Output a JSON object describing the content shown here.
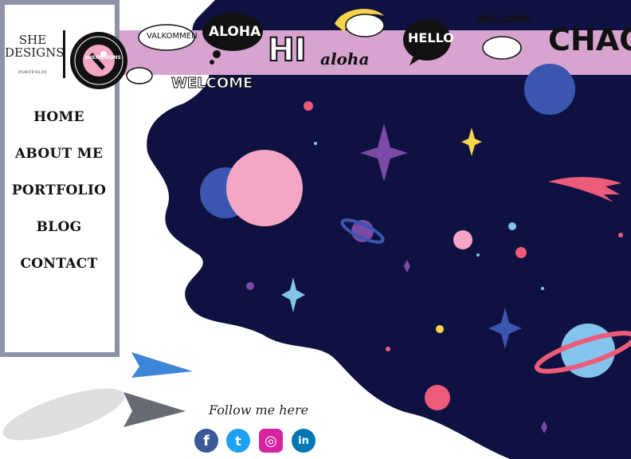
{
  "brand": {
    "line1": "SHE",
    "line2": "DESIGNS",
    "subtitle": "PORTFOLIO",
    "badge_text": "SHEIDESIGNS"
  },
  "nav": {
    "items": [
      {
        "label": "HOME"
      },
      {
        "label": "ABOUT ME"
      },
      {
        "label": "PORTFOLIO"
      },
      {
        "label": "BLOG"
      },
      {
        "label": "CONTACT"
      }
    ]
  },
  "greetings": {
    "valkommen": "VALKOMMEN",
    "aloha_bubble": "ALOHA",
    "hi": "HI",
    "aloha_script": "aloha",
    "hello": "HELLO",
    "welcome_small": "WELCOME",
    "welcome_large": "WELCOME",
    "chao": "CHAO"
  },
  "footer": {
    "follow_text": "Follow me here",
    "social": [
      {
        "name": "facebook",
        "glyph": "f",
        "color": "#3b5998"
      },
      {
        "name": "twitter",
        "glyph": "t",
        "color": "#1da1f2"
      },
      {
        "name": "instagram",
        "glyph": "◎",
        "color": "#d6249f"
      },
      {
        "name": "linkedin",
        "glyph": "in",
        "color": "#0077b5"
      }
    ]
  },
  "colors": {
    "space": "#0f1140",
    "band": "#d7a3cf",
    "sidebar_border": "#8c93a8"
  }
}
